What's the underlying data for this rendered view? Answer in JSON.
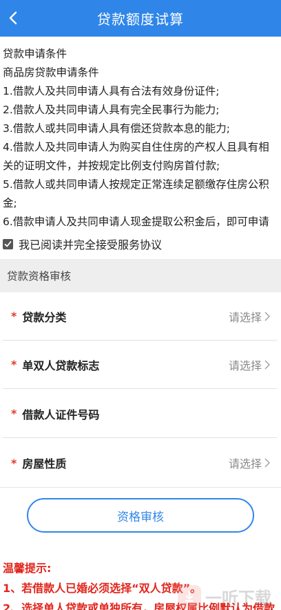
{
  "header": {
    "title": "贷款额度试算"
  },
  "terms": {
    "lines": [
      "贷款申请条件",
      "商品房贷款申请条件",
      "1.借款人及共同申请人具有合法有效身份证件;",
      "2.借款人及共同申请人具有完全民事行为能力;",
      "3.借款人或共同申请人具有偿还贷款本息的能力;",
      "4.借款人及共同申请人为购买自住住房的产权人且具有相关的证明文件，并按规定比例支付购房首付款;",
      "5.借款人或共同申请人按规定正常连续足额缴存住房公积金;",
      "6.借款申请人及共同申请人现金提取公积金后，即可申请"
    ]
  },
  "agree": {
    "label": "我已阅读并完全接受服务协议",
    "checked": true
  },
  "section": {
    "title": "贷款资格审核"
  },
  "form": {
    "star": "*",
    "select_placeholder": "请选择",
    "fields": [
      {
        "label": "贷款分类"
      },
      {
        "label": "单双人贷款标志"
      },
      {
        "label": "借款人证件号码"
      },
      {
        "label": "房屋性质"
      }
    ]
  },
  "submit": {
    "label": "资格审核"
  },
  "tips": {
    "title": "温馨提示:",
    "items": [
      "1、若借款人已婚必须选择“双人贷款”。",
      "2、选择单人贷款或单独所有，房屋权属比例默认为借款"
    ]
  },
  "watermark": {
    "text": "一听下载"
  },
  "colors": {
    "primary": "#2f86e8",
    "warning": "#e0251c"
  }
}
